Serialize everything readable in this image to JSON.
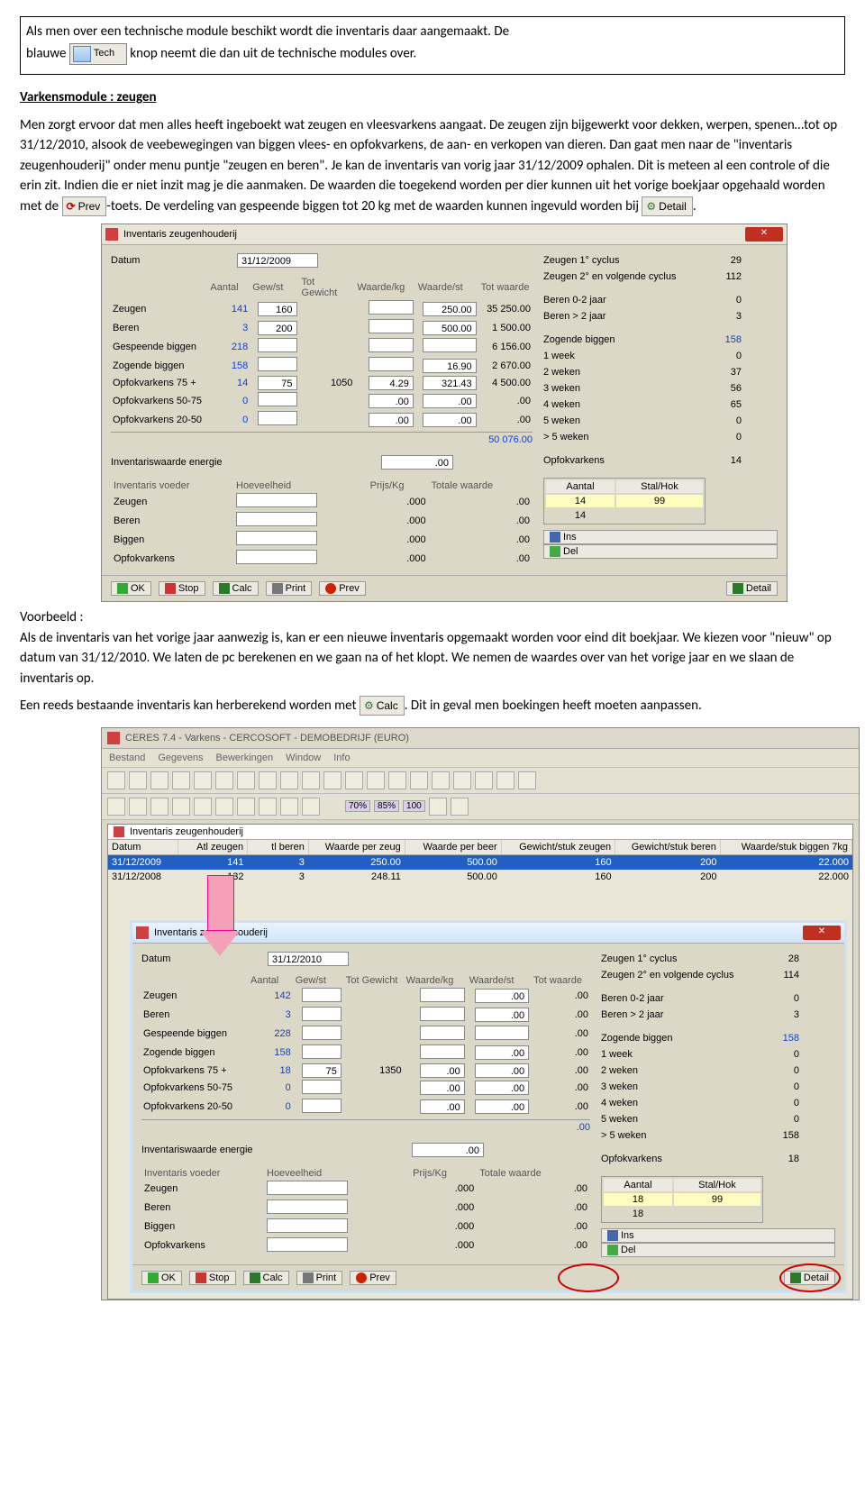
{
  "box": {
    "line1": "Als men over een technische module beschikt wordt die inventaris daar aangemaakt. De",
    "line2a": "blauwe",
    "line2b": "knop neemt die dan uit de technische modules over.",
    "tech_label": "Tech"
  },
  "heading": "Varkensmodule : zeugen",
  "para1": "Men zorgt ervoor dat men alles heeft ingeboekt wat zeugen en vleesvarkens aangaat. De zeugen zijn bijgewerkt voor dekken, werpen, spenen…tot op 31/12/2010, alsook de veebewegingen van biggen vlees- en opfokvarkens, de aan- en verkopen van dieren. Dan gaat men naar de \"inventaris zeugenhouderij\" onder menu puntje \"zeugen en beren\". Je kan de inventaris van vorig jaar 31/12/2009 ophalen. Dit is meteen al een controle of die erin zit. Indien die er niet inzit mag je die aanmaken. De waarden die toegekend worden per dier kunnen uit het vorige boekjaar opgehaald worden met de",
  "prev_label": "Prev",
  "para1b": "-toets. De verdeling van gespeende biggen tot 20 kg met de waarden kunnen ingevuld worden bij",
  "detail_label": "Detail",
  "period": ".",
  "shot1": {
    "title": "Inventaris zeugenhouderij",
    "datum_lbl": "Datum",
    "datum_val": "31/12/2009",
    "right": [
      {
        "l": "Zeugen 1° cyclus",
        "v": "29"
      },
      {
        "l": "Zeugen 2° en volgende cyclus",
        "v": "112"
      },
      {
        "l": "",
        "v": ""
      },
      {
        "l": "Beren 0-2 jaar",
        "v": "0"
      },
      {
        "l": "Beren > 2 jaar",
        "v": "3"
      },
      {
        "l": "",
        "v": ""
      },
      {
        "l": "Zogende biggen",
        "v": "158",
        "blue": true
      },
      {
        "l": "1 week",
        "v": "0"
      },
      {
        "l": "2 weken",
        "v": "37"
      },
      {
        "l": "3 weken",
        "v": "56"
      },
      {
        "l": "4 weken",
        "v": "65"
      },
      {
        "l": "5 weken",
        "v": "0"
      },
      {
        "l": "> 5 weken",
        "v": "0"
      },
      {
        "l": "",
        "v": ""
      },
      {
        "l": "Opfokvarkens",
        "v": "14"
      }
    ],
    "hdr": [
      "",
      "Aantal",
      "Gew/st",
      "Tot Gewicht",
      "Waarde/kg",
      "Waarde/st",
      "Tot waarde"
    ],
    "rows": [
      {
        "l": "Zeugen",
        "a": "141",
        "g": "160",
        "tg": "",
        "wk": "",
        "ws": "250.00",
        "tw": "35 250.00",
        "blue": true
      },
      {
        "l": "Beren",
        "a": "3",
        "g": "200",
        "tg": "",
        "wk": "",
        "ws": "500.00",
        "tw": "1 500.00",
        "blue": true
      },
      {
        "l": "Gespeende biggen",
        "a": "218",
        "g": "",
        "tg": "",
        "wk": "",
        "ws": "",
        "tw": "6 156.00"
      },
      {
        "l": "Zogende biggen",
        "a": "158",
        "g": "",
        "tg": "",
        "wk": "",
        "ws": "16.90",
        "tw": "2 670.00"
      },
      {
        "l": "Opfokvarkens 75 +",
        "a": "14",
        "g": "75",
        "tg": "1050",
        "wk": "4.29",
        "ws": "321.43",
        "tw": "4 500.00"
      },
      {
        "l": "Opfokvarkens 50-75",
        "a": "0",
        "g": "",
        "tg": "",
        "wk": ".00",
        "ws": ".00",
        "tw": ".00"
      },
      {
        "l": "Opfokvarkens 20-50",
        "a": "0",
        "g": "",
        "tg": "",
        "wk": ".00",
        "ws": ".00",
        "tw": ".00"
      }
    ],
    "total": "50 076.00",
    "energie_lbl": "Inventariswaarde energie",
    "energie_val": ".00",
    "voeder_hdr": [
      "Inventaris voeder",
      "Hoeveelheid",
      "Prijs/Kg",
      "Totale waarde"
    ],
    "voeder_rows": [
      "Zeugen",
      "Beren",
      "Biggen",
      "Opfokvarkens"
    ],
    "voeder_pk": ".000",
    "voeder_tw": ".00",
    "mini_hdr": [
      "Aantal",
      "Stal/Hok"
    ],
    "mini_r1": [
      "14",
      "99"
    ],
    "mini_r2": [
      "14",
      ""
    ],
    "btns": {
      "ok": "OK",
      "stop": "Stop",
      "calc": "Calc",
      "print": "Print",
      "prev": "Prev",
      "detail": "Detail",
      "ins": "Ins",
      "del": "Del"
    }
  },
  "voorbeeld_lbl": "Voorbeeld :",
  "para2": "Als de inventaris van het vorige jaar aanwezig is, kan er een nieuwe inventaris opgemaakt worden voor eind dit boekjaar. We kiezen voor \"nieuw\" op datum van 31/12/2010. We laten de pc berekenen en we gaan na of het klopt. We nemen de waardes over van het vorige jaar en we slaan de inventaris op.",
  "para3a": "Een reeds bestaande inventaris kan herberekend worden met",
  "calc_label": "Calc",
  "para3b": ". Dit in geval men boekingen heeft moeten aanpassen.",
  "shot2": {
    "apptitle": "CERES 7.4 - Varkens - CERCOSOFT - DEMOBEDRIJF (EURO)",
    "menu": [
      "Bestand",
      "Gegevens",
      "Bewerkingen",
      "Window",
      "Info"
    ],
    "subwin_title": "Inventaris zeugenhouderij",
    "list_hdr": [
      "Datum",
      "Atl zeugen",
      "tl beren",
      "Waarde per zeug",
      "Waarde per beer",
      "Gewicht/stuk zeugen",
      "Gewicht/stuk beren",
      "Waarde/stuk biggen 7kg"
    ],
    "list_rows": [
      {
        "d": "31/12/2009",
        "z": "141",
        "b": "3",
        "wz": "250.00",
        "wb": "500.00",
        "gz": "160",
        "gb": "200",
        "wbk": "22.000",
        "sel": true
      },
      {
        "d": "31/12/2008",
        "z": "132",
        "b": "3",
        "wz": "248.11",
        "wb": "500.00",
        "gz": "160",
        "gb": "200",
        "wbk": "22.000"
      }
    ],
    "dlg": {
      "title": "Inventaris zeugenhouderij",
      "datum_lbl": "Datum",
      "datum_val": "31/12/2010",
      "right": [
        {
          "l": "Zeugen 1° cyclus",
          "v": "28"
        },
        {
          "l": "Zeugen 2° en volgende cyclus",
          "v": "114"
        },
        {
          "l": "",
          "v": ""
        },
        {
          "l": "Beren 0-2 jaar",
          "v": "0"
        },
        {
          "l": "Beren > 2 jaar",
          "v": "3"
        },
        {
          "l": "",
          "v": ""
        },
        {
          "l": "Zogende biggen",
          "v": "158",
          "blue": true
        },
        {
          "l": "1 week",
          "v": "0"
        },
        {
          "l": "2 weken",
          "v": "0"
        },
        {
          "l": "3 weken",
          "v": "0"
        },
        {
          "l": "4 weken",
          "v": "0"
        },
        {
          "l": "5 weken",
          "v": "0"
        },
        {
          "l": "> 5 weken",
          "v": "158"
        },
        {
          "l": "",
          "v": ""
        },
        {
          "l": "Opfokvarkens",
          "v": "18"
        }
      ],
      "hdr": [
        "",
        "Aantal",
        "Gew/st",
        "Tot Gewicht",
        "Waarde/kg",
        "Waarde/st",
        "Tot waarde"
      ],
      "rows": [
        {
          "l": "Zeugen",
          "a": "142",
          "g": "",
          "tg": "",
          "wk": "",
          "ws": ".00",
          "tw": ".00",
          "blue": true
        },
        {
          "l": "Beren",
          "a": "3",
          "g": "",
          "tg": "",
          "wk": "",
          "ws": ".00",
          "tw": ".00",
          "blue": true
        },
        {
          "l": "Gespeende biggen",
          "a": "228",
          "g": "",
          "tg": "",
          "wk": "",
          "ws": "",
          "tw": ".00"
        },
        {
          "l": "Zogende biggen",
          "a": "158",
          "g": "",
          "tg": "",
          "wk": "",
          "ws": ".00",
          "tw": ".00"
        },
        {
          "l": "Opfokvarkens 75 +",
          "a": "18",
          "g": "75",
          "tg": "1350",
          "wk": ".00",
          "ws": ".00",
          "tw": ".00"
        },
        {
          "l": "Opfokvarkens 50-75",
          "a": "0",
          "g": "",
          "tg": "",
          "wk": ".00",
          "ws": ".00",
          "tw": ".00"
        },
        {
          "l": "Opfokvarkens 20-50",
          "a": "0",
          "g": "",
          "tg": "",
          "wk": ".00",
          "ws": ".00",
          "tw": ".00"
        }
      ],
      "total": ".00",
      "energie_lbl": "Inventariswaarde energie",
      "energie_val": ".00",
      "voeder_hdr": [
        "Inventaris voeder",
        "Hoeveelheid",
        "Prijs/Kg",
        "Totale waarde"
      ],
      "voeder_rows": [
        "Zeugen",
        "Beren",
        "Biggen",
        "Opfokvarkens"
      ],
      "voeder_pk": ".000",
      "voeder_tw": ".00",
      "mini_hdr": [
        "Aantal",
        "Stal/Hok"
      ],
      "mini_r1": [
        "18",
        "99"
      ],
      "mini_r2": [
        "18",
        ""
      ],
      "btns": {
        "ok": "OK",
        "stop": "Stop",
        "calc": "Calc",
        "print": "Print",
        "prev": "Prev",
        "detail": "Detail",
        "ins": "Ins",
        "del": "Del"
      }
    }
  }
}
